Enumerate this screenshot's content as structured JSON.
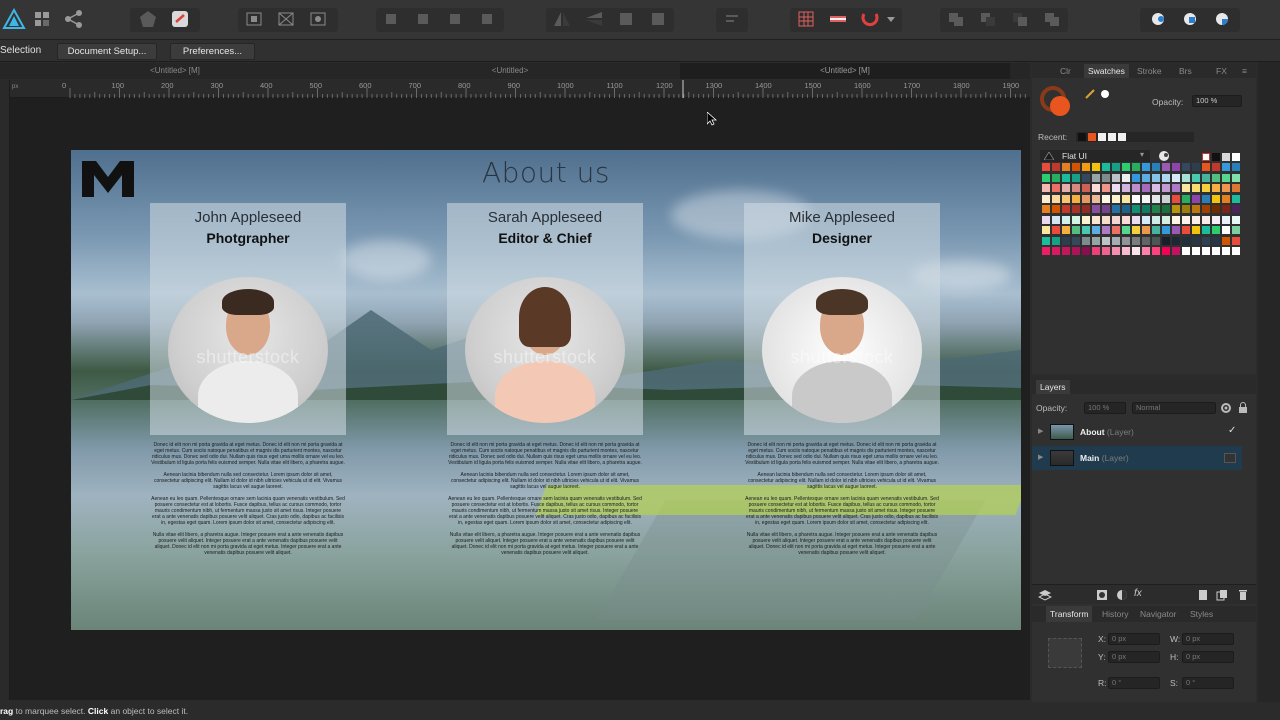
{
  "context_bar": {
    "mode_label": "Selection",
    "document_setup": "Document Setup...",
    "preferences": "Preferences..."
  },
  "doc_tabs": [
    "<Untitled> [M]",
    "<Untitled>",
    "<Untitled> [M]"
  ],
  "ruler": {
    "unit": "px",
    "ticks": [
      "0",
      "100",
      "200",
      "300",
      "400",
      "500",
      "600",
      "700",
      "800",
      "900",
      "1000",
      "1100",
      "1200",
      "1300",
      "1400",
      "1500",
      "1600",
      "1700",
      "1800",
      "1900"
    ]
  },
  "artboard": {
    "headline": "About us",
    "watermark": "shutterstock",
    "people": [
      {
        "name": "John Appleseed",
        "role": "Photgrapher"
      },
      {
        "name": "Sarah Appleseed",
        "role": "Editor & Chief"
      },
      {
        "name": "Mike Appleseed",
        "role": "Designer"
      }
    ],
    "bio_paragraphs": [
      "Donec id elit non mi porta gravida at eget metus. Donec id elit non mi porta gravida at eget metus. Cum sociis natoque penatibus et magnis dis parturient montes, nascetur ridiculus mus. Donec sed odio dui. Nullam quis risus eget urna mollis ornare vel eu leo. Vestibulum id ligula porta felis euismod semper. Nulla vitae elit libero, a pharetra augue.",
      "Aenean lacinia bibendum nulla sed consectetur. Lorem ipsum dolor sit amet, consectetur adipiscing elit. Nullam id dolor id nibh ultricies vehicula ut id elit. Vivamus sagittis lacus vel augue laoreet.",
      "Aenean eu leo quam. Pellentesque ornare sem lacinia quam venenatis vestibulum. Sed posuere consectetur est at lobortis. Fusce dapibus, tellus ac cursus commodo, tortor mauris condimentum nibh, ut fermentum massa justo sit amet risus. Integer posuere erat a ante venenatis dapibus posuere velit aliquet. Cras justo odio, dapibus ac facilisis in, egestas eget quam. Lorem ipsum dolor sit amet, consectetur adipiscing elit.",
      "Nulla vitae elit libero, a pharetra augue. Integer posuere erat a ante venenatis dapibus posuere velit aliquet. Integer posuere erat a ante venenatis dapibus posuere velit aliquet. Donec id elit non mi porta gravida at eget metus. Integer posuere erat a ante venenatis dapibus posuere velit aliquet."
    ]
  },
  "swatches_panel": {
    "tabs": [
      "Clr",
      "Swatches",
      "Stroke",
      "Brs",
      "FX"
    ],
    "active_tab": "Swatches",
    "opacity_label": "Opacity:",
    "opacity_value": "100 %",
    "recent_label": "Recent:",
    "palette_name": "Flat UI",
    "fill_color": "#e8551e",
    "stroke_color": "#8a3a1a"
  },
  "layers_panel": {
    "title": "Layers",
    "opacity_label": "Opacity:",
    "opacity_value": "100 %",
    "blend_mode": "Normal",
    "layers": [
      {
        "name": "About",
        "kind": "(Layer)",
        "visible": "✓"
      },
      {
        "name": "Main",
        "kind": "(Layer)",
        "visible": ""
      }
    ]
  },
  "transform_panel": {
    "tabs": [
      "Transform",
      "History",
      "Navigator",
      "Styles"
    ],
    "active_tab": "Transform",
    "fields": [
      {
        "label": "X:",
        "value": "0 px"
      },
      {
        "label": "W:",
        "value": "0 px"
      },
      {
        "label": "Y:",
        "value": "0 px"
      },
      {
        "label": "H:",
        "value": "0 px"
      },
      {
        "label": "R:",
        "value": "0 °"
      },
      {
        "label": "S:",
        "value": "0 °"
      }
    ]
  },
  "status_bar": {
    "drag_key": "rag",
    "drag_text": "to marquee select.",
    "click_key": "Click",
    "click_text": "an object to select it."
  }
}
